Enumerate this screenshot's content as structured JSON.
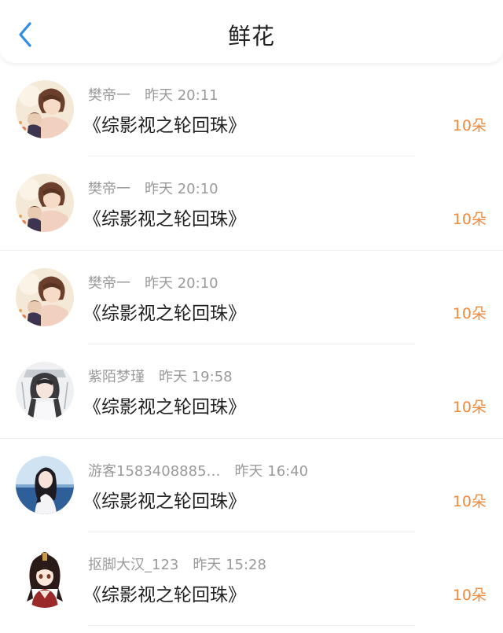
{
  "header": {
    "title": "鲜花",
    "back_icon": "chevron-left-icon",
    "accent": "#2e8de6"
  },
  "amount_color": "#f08a3c",
  "items": [
    {
      "user": "樊帝一",
      "time": "昨天 20:11",
      "book": "《综影视之轮回珠》",
      "amount": "10朵",
      "avatar": "anime-boy-avatar"
    },
    {
      "user": "樊帝一",
      "time": "昨天 20:10",
      "book": "《综影视之轮回珠》",
      "amount": "10朵",
      "avatar": "anime-boy-avatar"
    },
    {
      "user": "樊帝一",
      "time": "昨天 20:10",
      "book": "《综影视之轮回珠》",
      "amount": "10朵",
      "avatar": "anime-boy-avatar"
    },
    {
      "user": "紫陌梦瑾",
      "time": "昨天 19:58",
      "book": "《综影视之轮回珠》",
      "amount": "10朵",
      "avatar": "ancient-costume-avatar"
    },
    {
      "user": "游客1583408885…",
      "time": "昨天 16:40",
      "book": "《综影视之轮回珠》",
      "amount": "10朵",
      "avatar": "girl-by-sea-avatar"
    },
    {
      "user": "抠脚大汉_123",
      "time": "昨天 15:28",
      "book": "《综影视之轮回珠》",
      "amount": "10朵",
      "avatar": "anime-girl-avatar"
    }
  ]
}
